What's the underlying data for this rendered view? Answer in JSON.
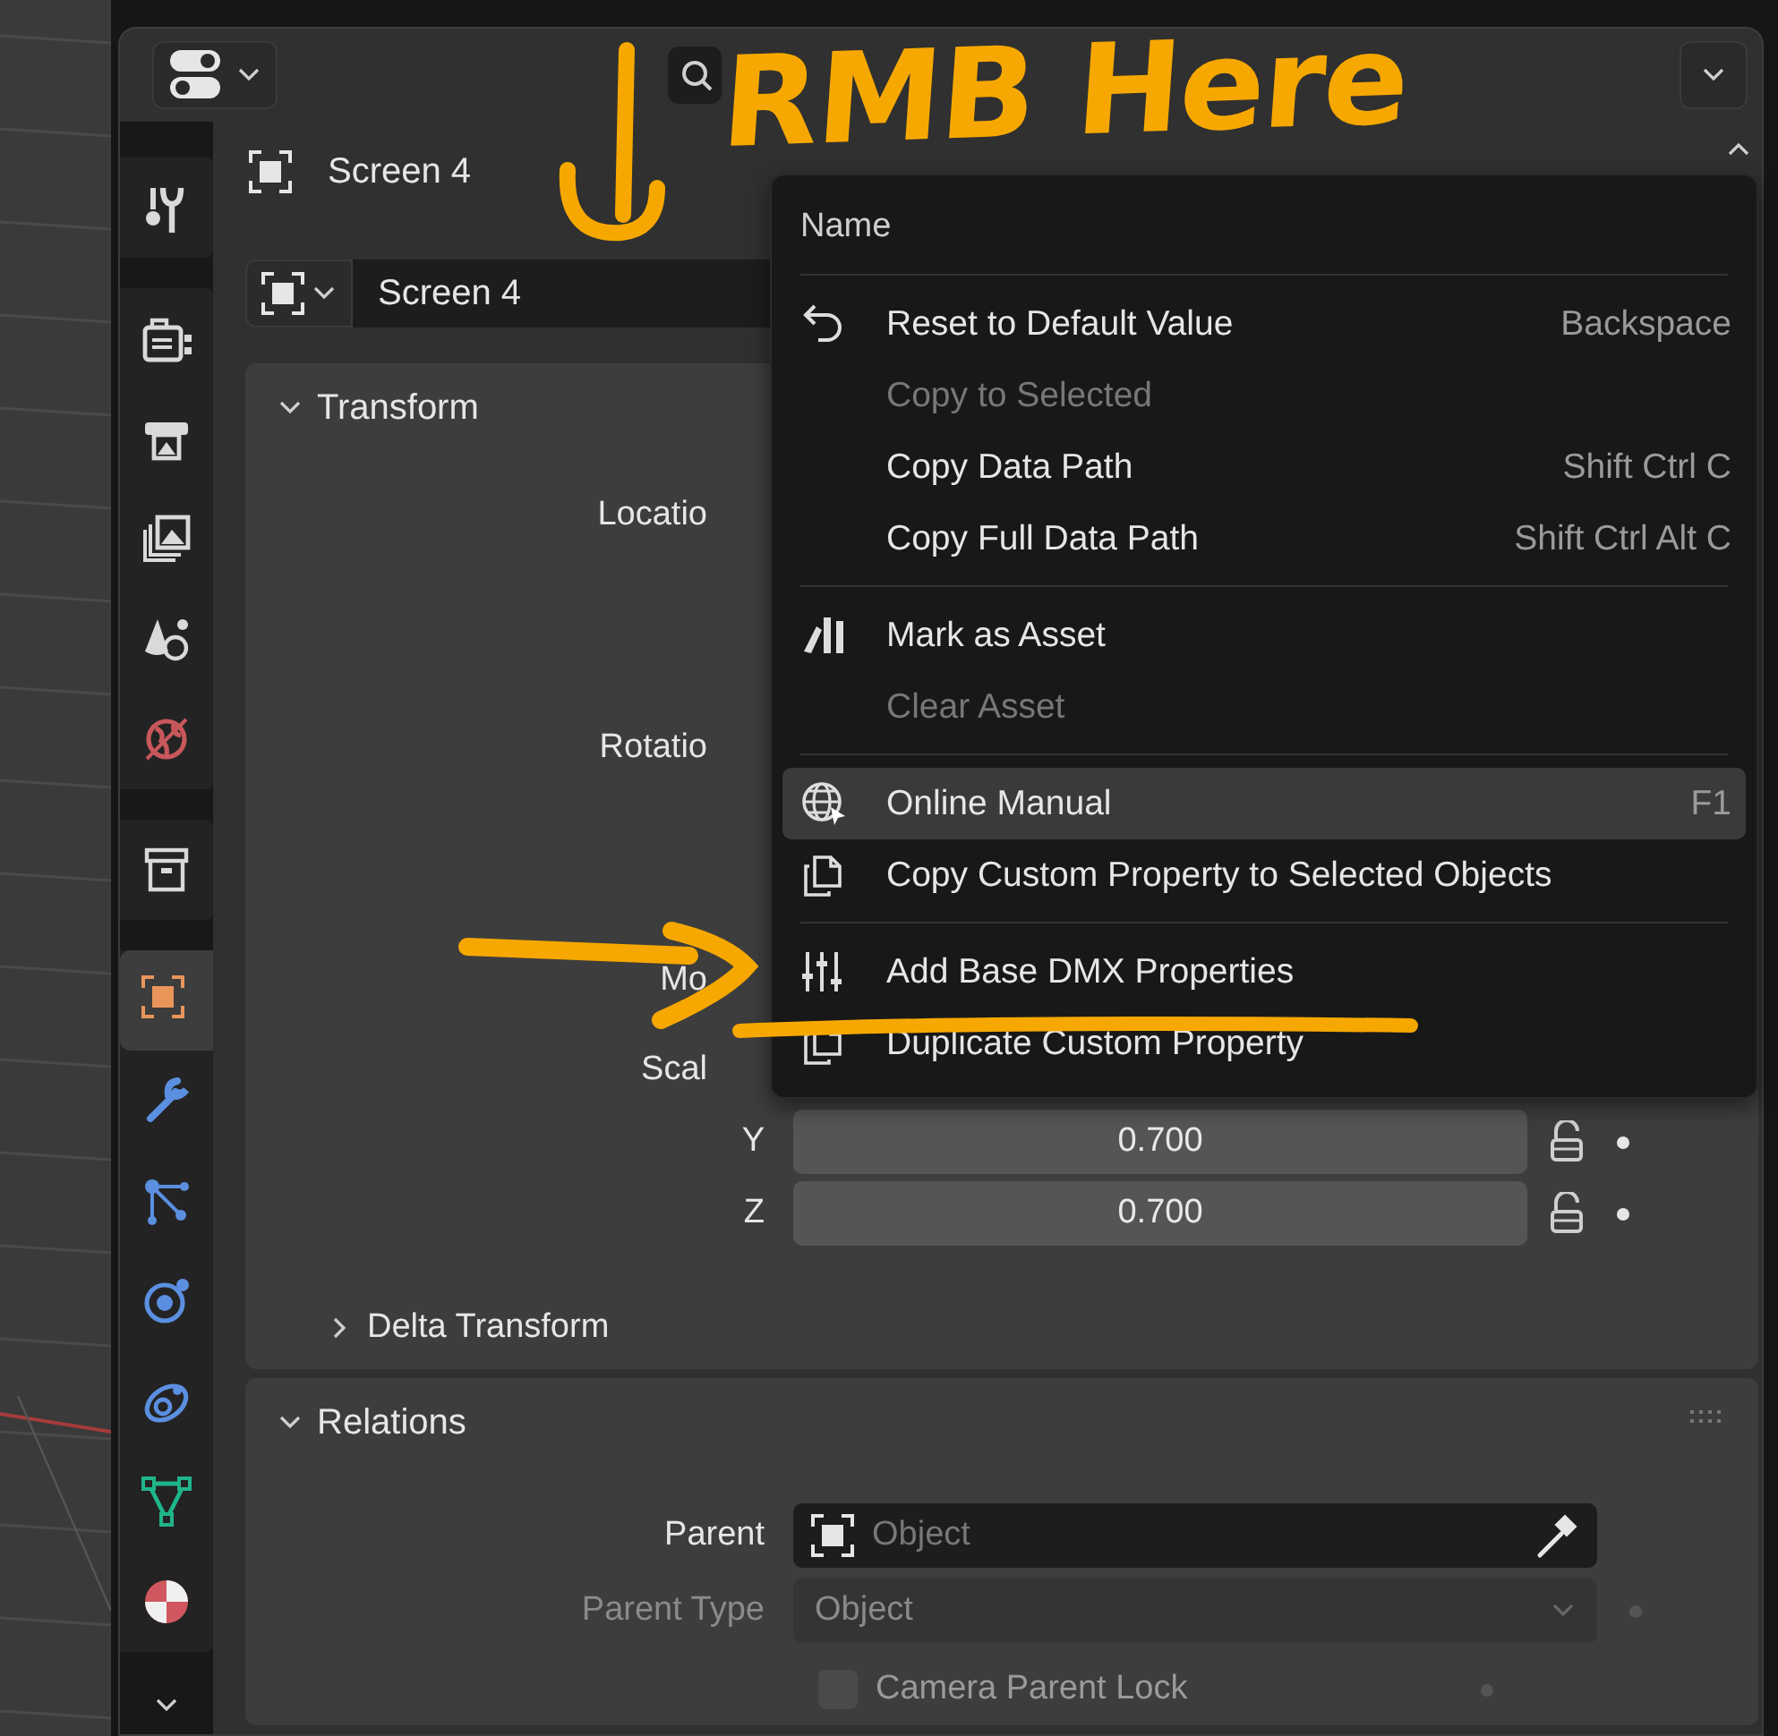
{
  "tab_groups": [
    [
      {
        "selected": false,
        "color": "#d9d9d9"
      }
    ],
    [
      {
        "selected": false,
        "color": "#d9d9d9"
      },
      {
        "selected": false,
        "color": "#d9d9d9"
      },
      {
        "selected": false,
        "color": "#d9d9d9"
      },
      {
        "selected": false,
        "color": "#d9d9d9"
      },
      {
        "selected": false,
        "color": "#c8575b"
      }
    ],
    [
      {
        "selected": false,
        "color": "#d9d9d9"
      }
    ],
    [
      {
        "selected": true,
        "color": "#e9955a"
      },
      {
        "selected": false,
        "color": "#5b8fe0"
      },
      {
        "selected": false,
        "color": "#5b8fe0"
      },
      {
        "selected": false,
        "color": "#5b8fe0"
      },
      {
        "selected": false,
        "color": "#5b8fe0"
      },
      {
        "selected": false,
        "color": "#1fb58a"
      },
      {
        "selected": false,
        "color": "#d0575f"
      }
    ]
  ],
  "object_title": "Screen 4",
  "object_name": "Screen 4",
  "transform": {
    "title": "Transform",
    "expanded": true,
    "rows": [
      {
        "kind": "label",
        "label": "Locatio"
      },
      {
        "kind": "label",
        "label": "Rotatio"
      },
      {
        "kind": "label",
        "label": "Mo"
      },
      {
        "kind": "label",
        "label": "Scal"
      },
      {
        "kind": "field",
        "label": "Y",
        "value": "0.700"
      },
      {
        "kind": "field",
        "label": "Z",
        "value": "0.700"
      }
    ],
    "subpanel": {
      "title": "Delta Transform",
      "expanded": false
    }
  },
  "relations": {
    "title": "Relations",
    "expanded": true,
    "rows": [
      {
        "kind": "object_field",
        "label": "Parent",
        "placeholder": "Object",
        "disabled": false
      },
      {
        "kind": "dropdown",
        "label": "Parent Type",
        "value": "Object",
        "disabled": true
      },
      {
        "kind": "checkbox",
        "label": "Camera Parent Lock",
        "checked": false,
        "disabled": true
      }
    ]
  },
  "context_menu": {
    "title": "Name",
    "sections": [
      [
        {
          "label": "Reset to Default Value",
          "shortcut": "Backspace",
          "disabled": false,
          "selected": false
        },
        {
          "label": "Copy to Selected",
          "disabled": true,
          "selected": false
        },
        {
          "label": "Copy Data Path",
          "shortcut": "Shift Ctrl C",
          "disabled": false,
          "selected": false
        },
        {
          "label": "Copy Full Data Path",
          "shortcut": "Shift Ctrl Alt C",
          "disabled": false,
          "selected": false
        }
      ],
      [
        {
          "label": "Mark as Asset",
          "disabled": false,
          "selected": false
        },
        {
          "label": "Clear Asset",
          "disabled": true,
          "selected": false
        }
      ],
      [
        {
          "label": "Online Manual",
          "shortcut": "F1",
          "disabled": false,
          "selected": true
        },
        {
          "label": "Copy Custom Property to Selected Objects",
          "disabled": false,
          "selected": false
        }
      ],
      [
        {
          "label": "Add Base DMX Properties",
          "disabled": false,
          "selected": false
        },
        {
          "label": "Duplicate Custom Property",
          "disabled": false,
          "selected": false
        }
      ]
    ]
  },
  "annotation": {
    "note": "RMB Here"
  }
}
